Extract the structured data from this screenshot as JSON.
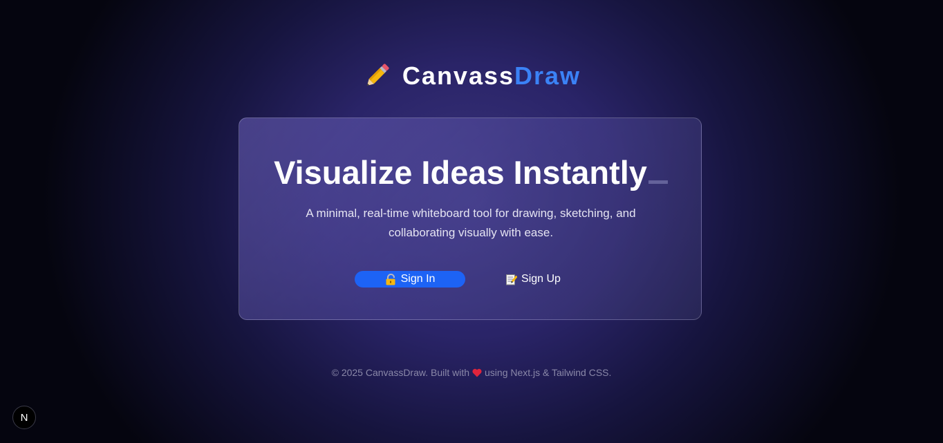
{
  "header": {
    "logo_icon": "pencil-icon",
    "brand_part1": "Canvass",
    "brand_part2": "Draw",
    "brand_color": "#3b82f6"
  },
  "hero": {
    "headline": "Visualize Ideas Instantly",
    "subtitle": "A minimal, real-time whiteboard tool for drawing, sketching, and collaborating visually with ease.",
    "signin": {
      "icon": "lock-icon",
      "label": "Sign In",
      "color": "#1d63f5"
    },
    "signup": {
      "icon": "memo-icon",
      "label": "Sign Up"
    }
  },
  "footer": {
    "text_before": "© 2025 CanvassDraw. Built with",
    "heart_icon": "heart-icon",
    "text_after": "using Next.js & Tailwind CSS."
  },
  "dev_badge": {
    "icon": "nextjs-icon",
    "letter": "N"
  }
}
